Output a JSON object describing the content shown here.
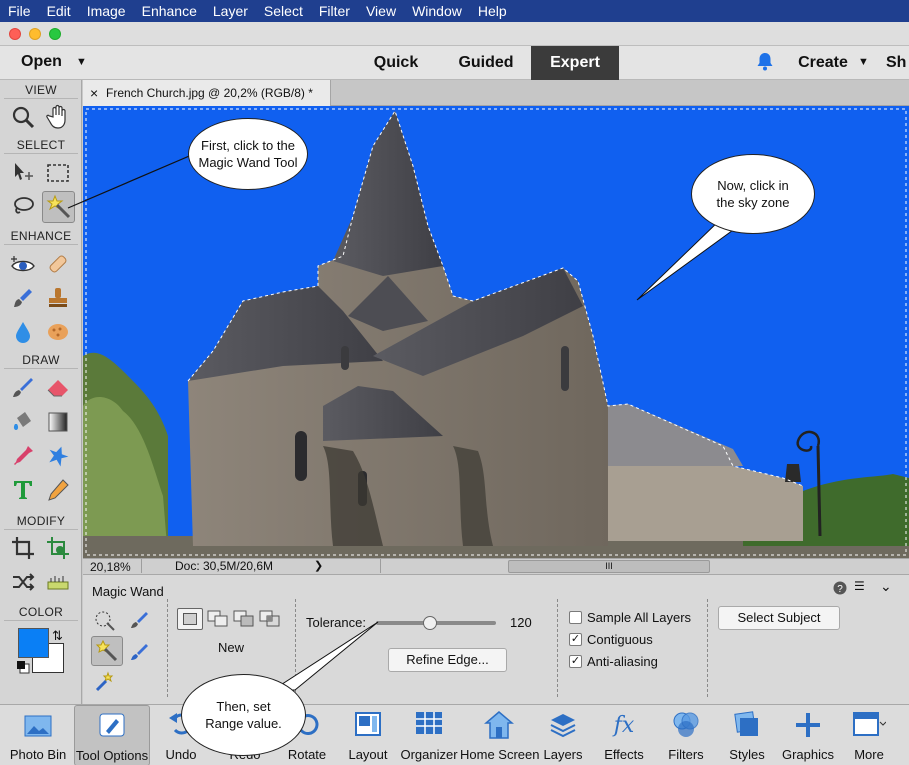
{
  "menubar": {
    "items": [
      "File",
      "Edit",
      "Image",
      "Enhance",
      "Layer",
      "Select",
      "Filter",
      "View",
      "Window",
      "Help"
    ]
  },
  "appbar": {
    "open_label": "Open",
    "modes": [
      "Quick",
      "Guided",
      "Expert"
    ],
    "active_mode": "Expert",
    "create_label": "Create",
    "share_label": "Sh"
  },
  "toolbox": {
    "sections": [
      "VIEW",
      "SELECT",
      "ENHANCE",
      "DRAW",
      "MODIFY",
      "COLOR"
    ],
    "foreground_color": "#0a7ff5",
    "background_color": "#ffffff"
  },
  "document": {
    "tab_title": "French Church.jpg @ 20,2% (RGB/8) *",
    "close_glyph": "×",
    "sky_color": "#1060f0"
  },
  "statusbar": {
    "zoom": "20,18%",
    "doc_info": "Doc: 30,5M/20,6M",
    "scroll_mark": "III"
  },
  "options": {
    "tool_name": "Magic Wand",
    "mode_label": "New",
    "tolerance_label": "Tolerance:",
    "tolerance_value": "120",
    "tolerance_fraction": 0.45,
    "refine_edge_label": "Refine Edge...",
    "sample_all_layers_label": "Sample All Layers",
    "sample_all_layers": false,
    "contiguous_label": "Contiguous",
    "contiguous": true,
    "anti_aliasing_label": "Anti-aliasing",
    "anti_aliasing": true,
    "select_subject_label": "Select Subject"
  },
  "bottombar": {
    "items": [
      "Photo Bin",
      "Tool Options",
      "Undo",
      "Redo",
      "Rotate",
      "Layout",
      "Organizer",
      "Home Screen",
      "Layers",
      "Effects",
      "Filters",
      "Styles",
      "Graphics",
      "More"
    ]
  },
  "callouts": {
    "first": "First, click to the Magic Wand Tool",
    "now": "Now, click in the sky zone",
    "then": "Then, set Range value."
  }
}
